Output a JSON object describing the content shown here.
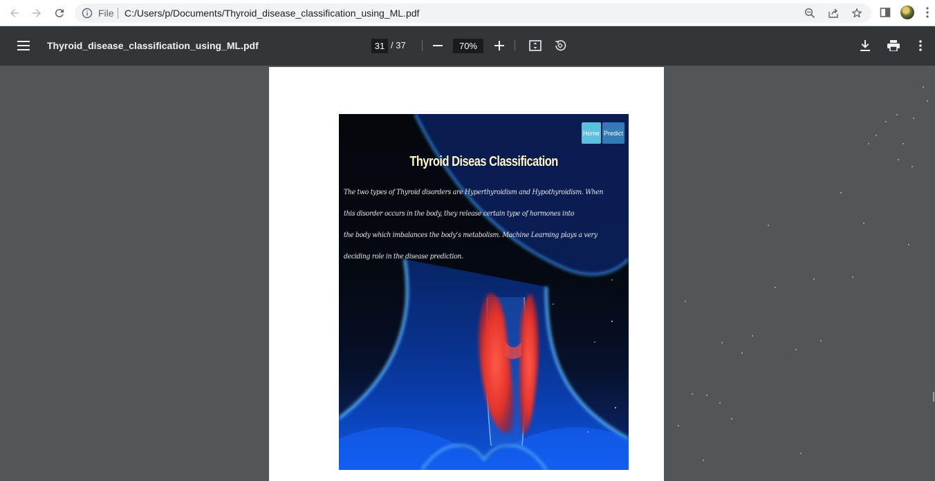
{
  "browser": {
    "scheme_label": "File",
    "url": "C:/Users/p/Documents/Thyroid_disease_classification_using_ML.pdf",
    "icons": [
      "back-icon",
      "forward-icon",
      "reload-icon",
      "info-icon",
      "zoom-icon",
      "share-icon",
      "star-icon",
      "side-panel-icon",
      "menu-dots-icon"
    ]
  },
  "pdf_toolbar": {
    "title": "Thyroid_disease_classification_using_ML.pdf",
    "current_page": "31",
    "total_pages": "/ 37",
    "zoom": "70%",
    "icons": [
      "hamburger-icon",
      "zoom-out-icon",
      "zoom-in-icon",
      "fit-page-icon",
      "rotate-icon",
      "download-icon",
      "print-icon",
      "more-icon"
    ]
  },
  "document": {
    "nav_home": "Home",
    "nav_predict": "Predict",
    "heading": "Thyroid Diseas Classification",
    "body_lines": [
      "The two types of Thyroid disorders are Hyperthyroidism and Hypothyroidism. When",
      "this disorder occurs in the body, they release certain type of hormones into",
      "the body which imbalances the body’s metabolism. Machine Learning plays a very",
      "deciding role in the disease prediction."
    ]
  },
  "colors": {
    "toolbar_bg": "#323639",
    "viewer_bg": "#525659",
    "home_button": "#5bc0de",
    "predict_button": "#337ab7",
    "heading_color": "#fff8d0"
  }
}
